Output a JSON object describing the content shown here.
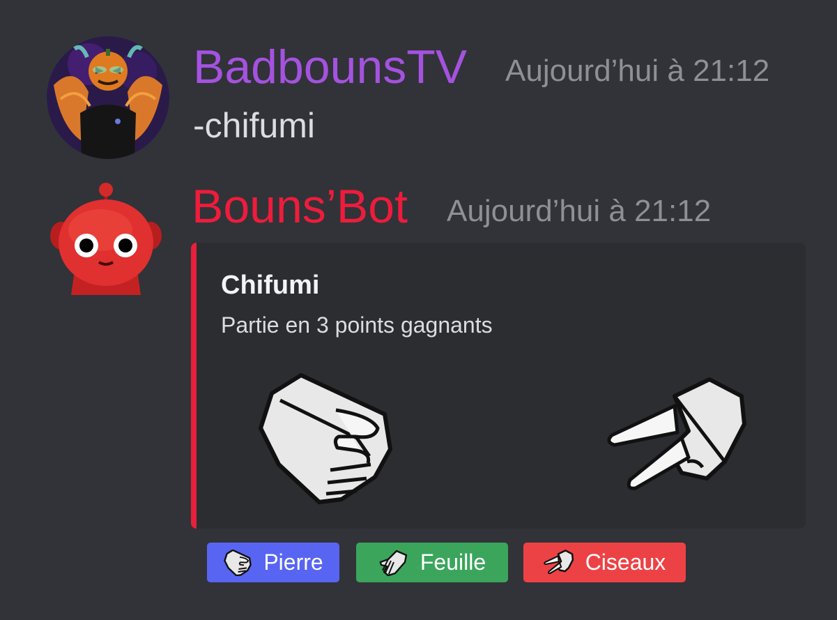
{
  "messages": [
    {
      "username": "BadbounsTV",
      "username_color": "#a552e0",
      "timestamp": "Aujourd’hui à 21:12",
      "content": "-chifumi",
      "avatar": "pumpkin-head-avatar"
    },
    {
      "username": "Bouns’Bot",
      "username_color": "#ee1c3c",
      "timestamp": "Aujourd’hui à 21:12",
      "avatar": "red-robot-avatar",
      "embed": {
        "accent_color": "#e8203b",
        "title": "Chifumi",
        "description": "Partie en 3 points gagnants",
        "hands": [
          "rock-hand-icon",
          "scissors-hand-icon"
        ]
      }
    }
  ],
  "buttons": [
    {
      "label": "Pierre",
      "icon": "rock-hand-icon",
      "color": "#5865f2"
    },
    {
      "label": "Feuille",
      "icon": "paper-hand-icon",
      "color": "#3ba55c"
    },
    {
      "label": "Ciseaux",
      "icon": "scissors-hand-icon",
      "color": "#ed4245"
    }
  ]
}
